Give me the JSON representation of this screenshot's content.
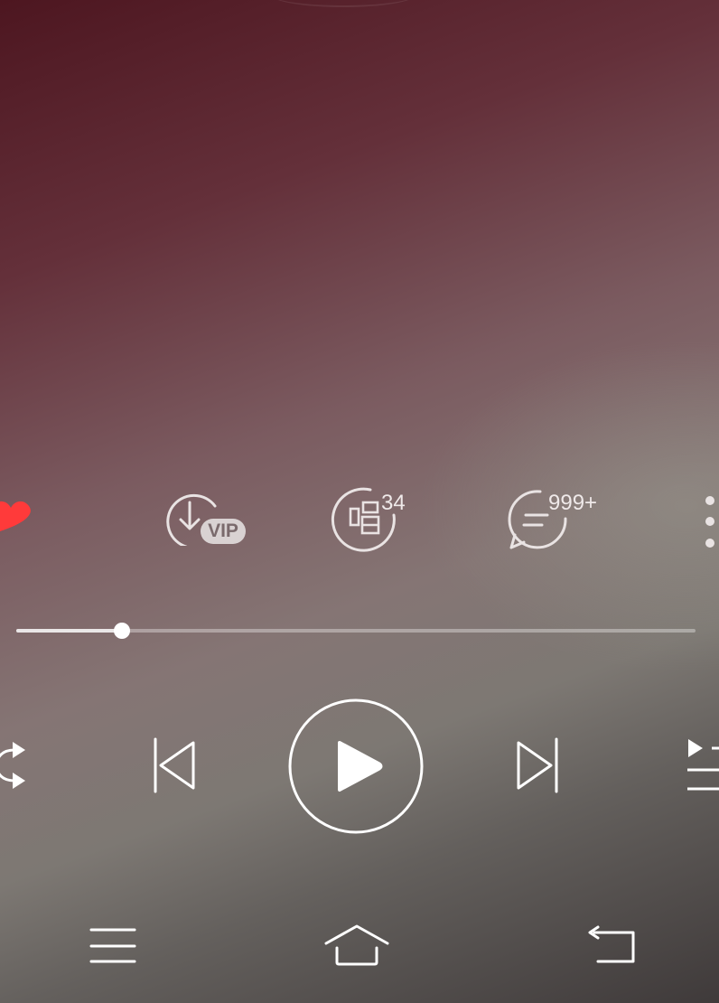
{
  "actions": {
    "download_badge": "VIP",
    "sing_count": "34",
    "comment_count": "999+"
  },
  "playback": {
    "progress_fraction": 0.155,
    "liked": true
  },
  "colors": {
    "like_red": "#ff3a3a",
    "icon_light": "#e9e3e3"
  },
  "icons": {
    "like": "heart-icon",
    "download": "download-icon",
    "sing": "sing-icon",
    "comment": "comment-icon",
    "more": "more-vertical-icon",
    "repeat": "repeat-icon",
    "previous": "previous-track-icon",
    "play": "play-icon",
    "next": "next-track-icon",
    "playlist": "playlist-icon",
    "menu": "menu-icon",
    "home": "home-icon",
    "back": "back-icon"
  }
}
